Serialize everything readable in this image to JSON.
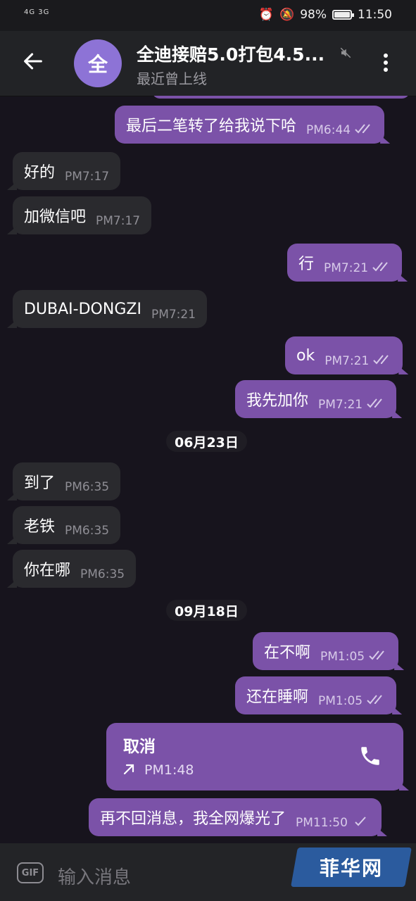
{
  "status_bar": {
    "signal": "4G 3G",
    "battery_percent": "98%",
    "time": "11:50"
  },
  "header": {
    "avatar_letter": "全",
    "title": "全迪接赔5.0打包4.5...",
    "subtitle": "最近曾上线"
  },
  "messages": [
    {
      "dir": "out",
      "text": "最后二笔转了给我说下哈",
      "time": "PM6:44"
    },
    {
      "dir": "in",
      "text": "好的",
      "time": "PM7:17"
    },
    {
      "dir": "in",
      "text": "加微信吧",
      "time": "PM7:17"
    },
    {
      "dir": "out",
      "text": "行",
      "time": "PM7:21"
    },
    {
      "dir": "in",
      "text": "DUBAI-DONGZI",
      "time": "PM7:21"
    },
    {
      "dir": "out",
      "text": "ok",
      "time": "PM7:21"
    },
    {
      "dir": "out",
      "text": "我先加你",
      "time": "PM7:21"
    },
    {
      "dir": "in",
      "text": "到了",
      "time": "PM6:35"
    },
    {
      "dir": "in",
      "text": "老铁",
      "time": "PM6:35"
    },
    {
      "dir": "in",
      "text": "你在哪",
      "time": "PM6:35"
    },
    {
      "dir": "out",
      "text": "在不啊",
      "time": "PM1:05"
    },
    {
      "dir": "out",
      "text": "还在睡啊",
      "time": "PM1:05"
    },
    {
      "dir": "out",
      "text": "再不回消息，我全网爆光了",
      "time": "PM11:50"
    }
  ],
  "dates": [
    "06月23日",
    "09月18日"
  ],
  "call": {
    "title": "取消",
    "time": "PM1:48"
  },
  "input": {
    "gif_label": "GIF",
    "placeholder": "输入消息"
  },
  "watermark": "菲华网"
}
